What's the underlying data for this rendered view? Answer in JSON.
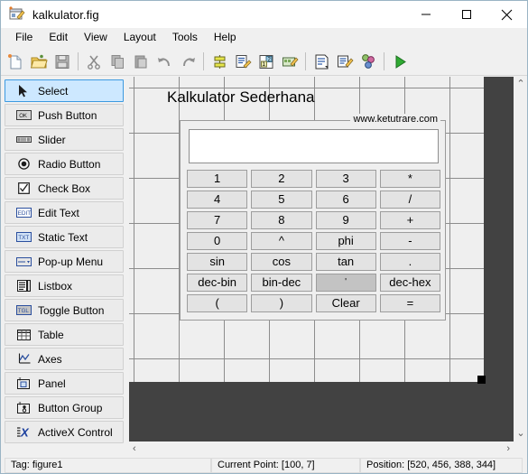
{
  "window": {
    "title": "kalkulator.fig",
    "icon": "guide-figure-icon",
    "minimize_label": "—",
    "maximize_label": "□",
    "close_label": "✕"
  },
  "menubar": {
    "items": [
      {
        "label": "File"
      },
      {
        "label": "Edit"
      },
      {
        "label": "View"
      },
      {
        "label": "Layout"
      },
      {
        "label": "Tools"
      },
      {
        "label": "Help"
      }
    ]
  },
  "toolbar": {
    "buttons": [
      {
        "name": "new-figure-icon",
        "tip": "New"
      },
      {
        "name": "open-folder-icon",
        "tip": "Open"
      },
      {
        "name": "save-disk-icon",
        "tip": "Save"
      },
      {
        "name": "cut-scissors-icon",
        "tip": "Cut"
      },
      {
        "name": "copy-icon",
        "tip": "Copy"
      },
      {
        "name": "paste-icon",
        "tip": "Paste"
      },
      {
        "name": "undo-arrow-icon",
        "tip": "Undo"
      },
      {
        "name": "redo-arrow-icon",
        "tip": "Redo"
      },
      {
        "name": "align-objects-icon",
        "tip": "Align Objects"
      },
      {
        "name": "menu-editor-icon",
        "tip": "Menu Editor"
      },
      {
        "name": "tab-order-editor-icon",
        "tip": "Tab Order Editor"
      },
      {
        "name": "toolbar-editor-icon",
        "tip": "Toolbar Editor"
      },
      {
        "name": "m-file-editor-icon",
        "tip": "M-file Editor"
      },
      {
        "name": "property-inspector-icon",
        "tip": "Property Inspector"
      },
      {
        "name": "object-browser-icon",
        "tip": "Object Browser"
      },
      {
        "name": "run-figure-icon",
        "tip": "Run"
      }
    ]
  },
  "palette": {
    "items": [
      {
        "label": "Select",
        "icon": "cursor-arrow-icon",
        "selected": true
      },
      {
        "label": "Push Button",
        "icon": "push-button-icon",
        "selected": false
      },
      {
        "label": "Slider",
        "icon": "slider-icon",
        "selected": false
      },
      {
        "label": "Radio Button",
        "icon": "radio-button-icon",
        "selected": false
      },
      {
        "label": "Check Box",
        "icon": "check-box-icon",
        "selected": false
      },
      {
        "label": "Edit Text",
        "icon": "edit-text-icon",
        "selected": false
      },
      {
        "label": "Static Text",
        "icon": "static-text-icon",
        "selected": false
      },
      {
        "label": "Pop-up Menu",
        "icon": "popup-menu-icon",
        "selected": false
      },
      {
        "label": "Listbox",
        "icon": "listbox-icon",
        "selected": false
      },
      {
        "label": "Toggle Button",
        "icon": "toggle-button-icon",
        "selected": false
      },
      {
        "label": "Table",
        "icon": "table-icon",
        "selected": false
      },
      {
        "label": "Axes",
        "icon": "axes-icon",
        "selected": false
      },
      {
        "label": "Panel",
        "icon": "panel-icon",
        "selected": false
      },
      {
        "label": "Button Group",
        "icon": "button-group-icon",
        "selected": false
      },
      {
        "label": "ActiveX Control",
        "icon": "activex-control-icon",
        "selected": false
      }
    ]
  },
  "figure": {
    "static_title": "Kalkulator Sederhana",
    "panel_title": "www.ketutrare.com",
    "display_value": "",
    "display_placeholder": "",
    "buttons": [
      {
        "label": "1",
        "selected": false
      },
      {
        "label": "2",
        "selected": false
      },
      {
        "label": "3",
        "selected": false
      },
      {
        "label": "*",
        "selected": false
      },
      {
        "label": "4",
        "selected": false
      },
      {
        "label": "5",
        "selected": false
      },
      {
        "label": "6",
        "selected": false
      },
      {
        "label": "/",
        "selected": false
      },
      {
        "label": "7",
        "selected": false
      },
      {
        "label": "8",
        "selected": false
      },
      {
        "label": "9",
        "selected": false
      },
      {
        "label": "+",
        "selected": false
      },
      {
        "label": "0",
        "selected": false
      },
      {
        "label": "^",
        "selected": false
      },
      {
        "label": "phi",
        "selected": false
      },
      {
        "label": "-",
        "selected": false
      },
      {
        "label": "sin",
        "selected": false
      },
      {
        "label": "cos",
        "selected": false
      },
      {
        "label": "tan",
        "selected": false
      },
      {
        "label": ".",
        "selected": false
      },
      {
        "label": "dec-bin",
        "selected": false
      },
      {
        "label": "bin-dec",
        "selected": false
      },
      {
        "label": "'",
        "selected": true
      },
      {
        "label": "dec-hex",
        "selected": false
      },
      {
        "label": "(",
        "selected": false
      },
      {
        "label": ")",
        "selected": false
      },
      {
        "label": "Clear",
        "selected": false
      },
      {
        "label": "=",
        "selected": false
      }
    ]
  },
  "scrollbars": {
    "up_arrow": "⌃",
    "down_arrow": "⌄",
    "left_arrow": "‹",
    "right_arrow": "›"
  },
  "statusbar": {
    "tag": "Tag: figure1",
    "current_point": "Current Point:  [100, 7]",
    "position": "Position: [520, 456, 388, 344]"
  },
  "colors": {
    "canvas_dark": "#424242",
    "figure_bg": "#efefef",
    "selection_blue": "#cde8ff",
    "accent_teal": "#22b8c4"
  }
}
